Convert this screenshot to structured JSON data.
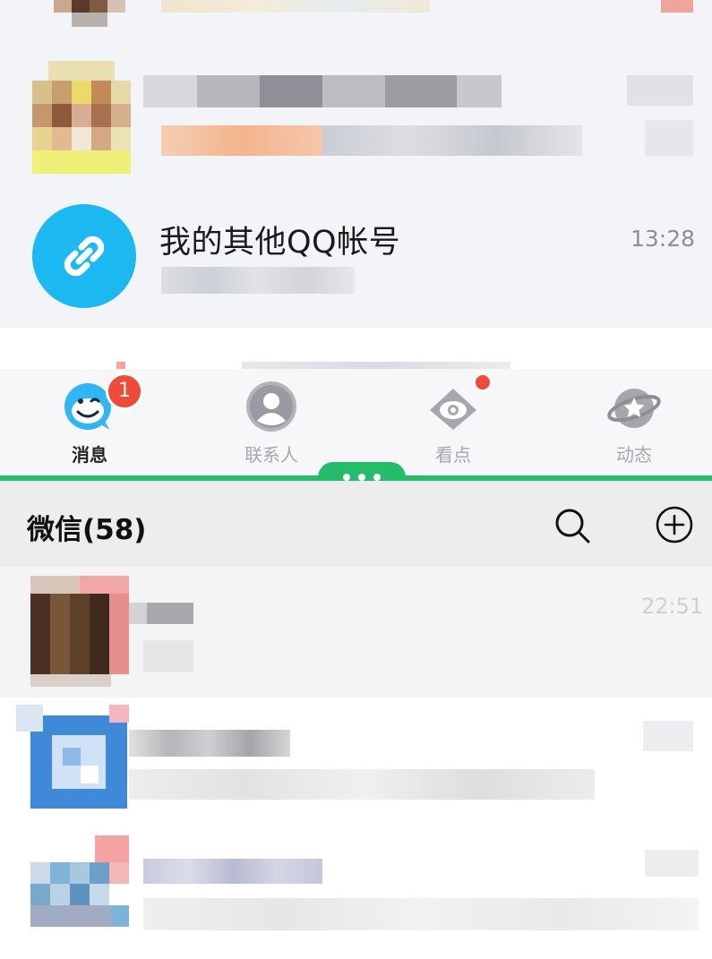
{
  "qq": {
    "conversations": [
      {
        "name": "我的其他QQ帐号",
        "time": "13:28",
        "avatar_icon": "link-icon"
      }
    ],
    "tabs": [
      {
        "label": "消息",
        "icon": "smiley-penguin-icon",
        "badge": "1",
        "active": true
      },
      {
        "label": "联系人",
        "icon": "contact-person-icon",
        "active": false
      },
      {
        "label": "看点",
        "icon": "eye-icon",
        "has_dot": true,
        "active": false
      },
      {
        "label": "动态",
        "icon": "planet-star-icon",
        "active": false
      }
    ]
  },
  "divider": {
    "handle_icon": "more-dots-icon"
  },
  "wechat": {
    "title": "微信(58)",
    "search_icon": "search-icon",
    "add_icon": "add-circle-icon",
    "conversations": [
      {
        "time": "22:51"
      }
    ]
  },
  "colors": {
    "accent_green": "#23bd6b",
    "qq_blue": "#1bb8f1",
    "badge_red": "#f24a38",
    "tab_inactive": "#a6a6ad"
  }
}
